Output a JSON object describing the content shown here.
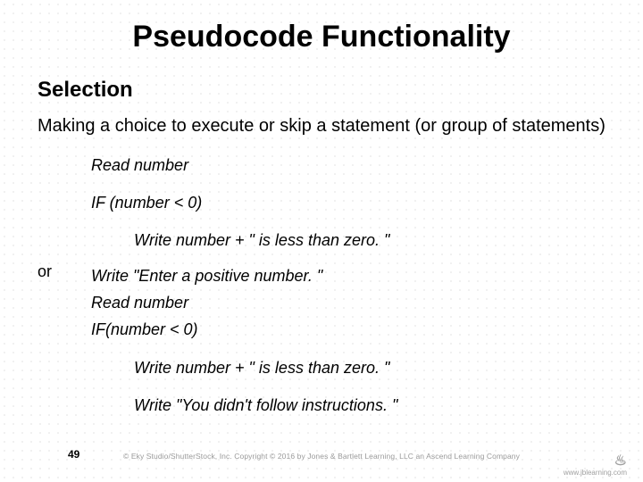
{
  "title": "Pseudocode Functionality",
  "subtitle": "Selection",
  "intro": "Making a choice to execute or skip a statement (or group of statements)",
  "block1": {
    "l1": "Read number",
    "l2": "IF (number < 0)",
    "l3": "Write number + \" is less than zero. \""
  },
  "or_label": "or",
  "block2": {
    "l1": "Write \"Enter a positive number. \"",
    "l2": "Read number",
    "l3": "IF(number < 0)",
    "l4": "Write number + \" is less than zero. \"",
    "l5": "Write \"You didn't follow instructions. \""
  },
  "page_number": "49",
  "copyright": "© Eky Studio/ShutterStock, Inc. Copyright © 2016 by Jones & Bartlett Learning, LLC an Ascend Learning Company",
  "logo_url": "www.jblearning.com"
}
